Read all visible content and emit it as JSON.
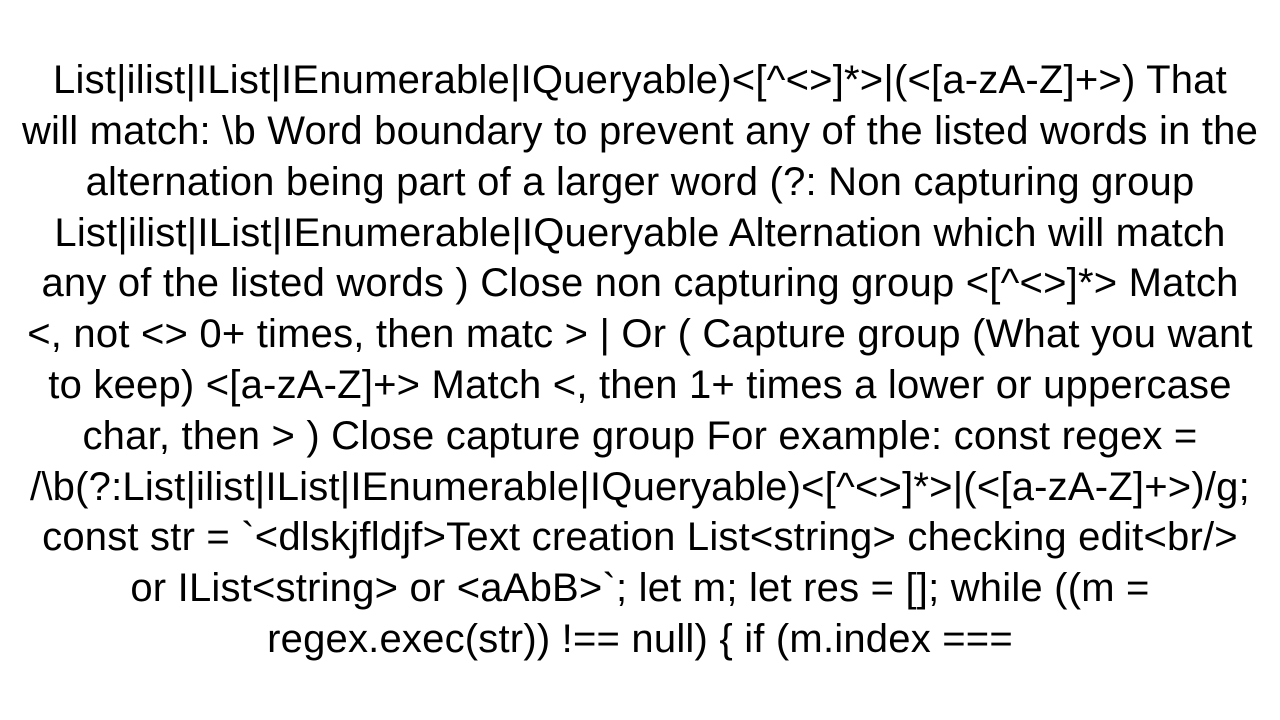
{
  "document": {
    "text": "List|ilist|IList|IEnumerable|IQueryable)<[^<>]*>|(<[a-zA-Z]+>)  That will match:  \\b Word boundary to prevent any of the listed words in the alternation being part of a larger word (?: Non capturing group List|ilist|IList|IEnumerable|IQueryable Alternation which will match any of the listed words ) Close non capturing group <[^<>]*> Match <, not <> 0+ times, then matc > | Or ( Capture group (What you want to keep) <[a-zA-Z]+> Match <, then 1+ times a lower or uppercase char, then > ) Close capture group  For example:   const regex = /\\b(?:List|ilist|IList|IEnumerable|IQueryable)<[^<>]*>|(<[a-zA-Z]+>)/g; const str = `<dlskjfldjf>Text creation List<string> checking edit<br/> or IList<string> or <aAbB>`; let m; let res = [];  while ((m = regex.exec(str)) !== null) {   if (m.index ==="
  }
}
